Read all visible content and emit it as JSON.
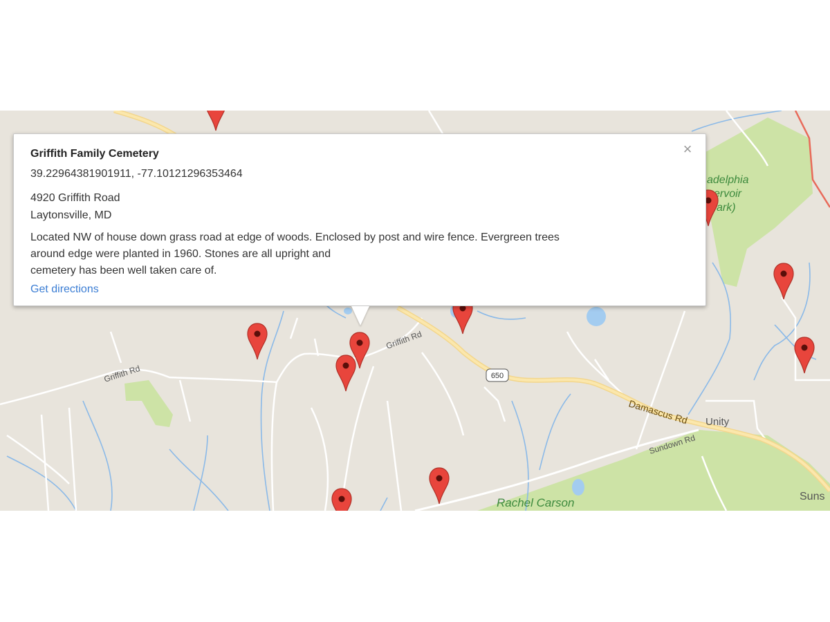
{
  "map": {
    "labels": {
      "griffith_rd_west": "Griffith Rd",
      "griffith_rd_east": "Griffith Rd",
      "route_shield": "650",
      "damascus_rd": "Damascus Rd",
      "unity": "Unity",
      "sundown_rd": "Sundown Rd",
      "rachel_carson": "Rachel Carson",
      "park_name_line1": "adelphia",
      "park_name_line2": "ervoir",
      "park_name_line3": "ark)",
      "suns": "Suns"
    },
    "marker_icon": "map-pin-icon",
    "marker_color": "#e8453c"
  },
  "infowindow": {
    "title": "Griffith Family Cemetery",
    "coordinates": "39.22964381901911, -77.10121296353464",
    "address_line1": "4920 Griffith Road",
    "address_line2": "Laytonsville, MD",
    "description_lines": [
      "Located NW of house down grass road at edge of woods. Enclosed by post and wire fence. Evergreen trees",
      "around edge were planted in 1960. Stones are all upright and",
      "cemetery has been well taken care of."
    ],
    "directions_label": "Get directions",
    "close_icon": "close-icon",
    "close_glyph": "×"
  }
}
